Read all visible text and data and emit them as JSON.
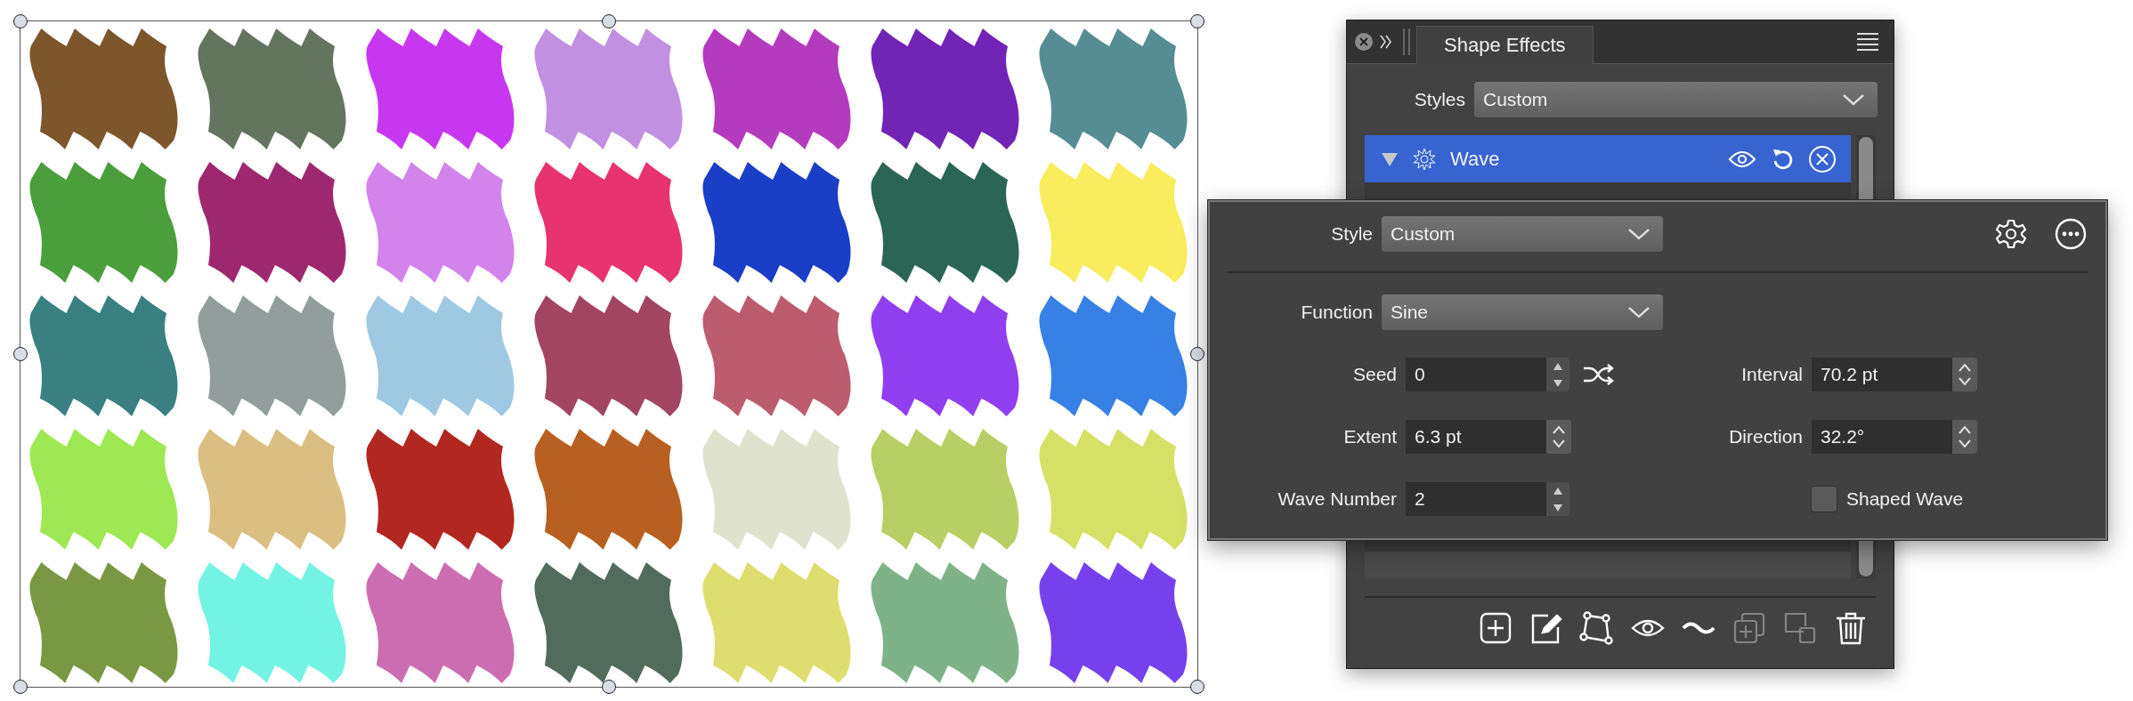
{
  "canvas": {
    "shapes": [
      {
        "color": "#7d562c"
      },
      {
        "color": "#63745f"
      },
      {
        "color": "#c837f0"
      },
      {
        "color": "#c290e1"
      },
      {
        "color": "#b43bbd"
      },
      {
        "color": "#7124b5"
      },
      {
        "color": "#568d94"
      },
      {
        "color": "#4a9e3b"
      },
      {
        "color": "#9e2870"
      },
      {
        "color": "#d383ec"
      },
      {
        "color": "#e73470"
      },
      {
        "color": "#1b3ec6"
      },
      {
        "color": "#2b6556"
      },
      {
        "color": "#f9ec5d"
      },
      {
        "color": "#3a8083"
      },
      {
        "color": "#929e9c"
      },
      {
        "color": "#9fc8e3"
      },
      {
        "color": "#a24562"
      },
      {
        "color": "#bd5c6f"
      },
      {
        "color": "#913ef0"
      },
      {
        "color": "#3780e6"
      },
      {
        "color": "#9de853"
      },
      {
        "color": "#dbbf82"
      },
      {
        "color": "#b2271f"
      },
      {
        "color": "#b86021"
      },
      {
        "color": "#dfe2cd"
      },
      {
        "color": "#b8cf66"
      },
      {
        "color": "#d4e166"
      },
      {
        "color": "#7a9843"
      },
      {
        "color": "#73f3e3"
      },
      {
        "color": "#cd6db1"
      },
      {
        "color": "#516c5b"
      },
      {
        "color": "#dedd6f"
      },
      {
        "color": "#7fb387"
      },
      {
        "color": "#7641ed"
      }
    ]
  },
  "panel": {
    "tab": "Shape Effects",
    "styles_label": "Styles",
    "styles_value": "Custom",
    "effects": [
      {
        "name": "Wave",
        "selected": true,
        "expanded": true
      }
    ],
    "toolbar": [
      {
        "kind": "add",
        "disabled": false
      },
      {
        "kind": "edit",
        "disabled": false
      },
      {
        "kind": "nodes",
        "disabled": false
      },
      {
        "kind": "eye",
        "disabled": false
      },
      {
        "kind": "wave",
        "disabled": false
      },
      {
        "kind": "duplicate",
        "disabled": true
      },
      {
        "kind": "group",
        "disabled": true
      },
      {
        "kind": "trash",
        "disabled": false
      }
    ]
  },
  "popup": {
    "style_label": "Style",
    "style_value": "Custom",
    "function_label": "Function",
    "function_value": "Sine",
    "fields": [
      {
        "label": "Seed",
        "value": "0",
        "kind": "arrows",
        "random": true
      },
      {
        "label": "Interval",
        "value": "70.2 pt",
        "kind": "spinner"
      },
      {
        "label": "Extent",
        "value": "6.3 pt",
        "kind": "spinner"
      },
      {
        "label": "Direction",
        "value": "32.2°",
        "kind": "spinner"
      },
      {
        "label": "Wave Number",
        "value": "2",
        "kind": "arrows"
      }
    ],
    "shaped_wave": {
      "label": "Shaped Wave",
      "checked": false
    }
  }
}
